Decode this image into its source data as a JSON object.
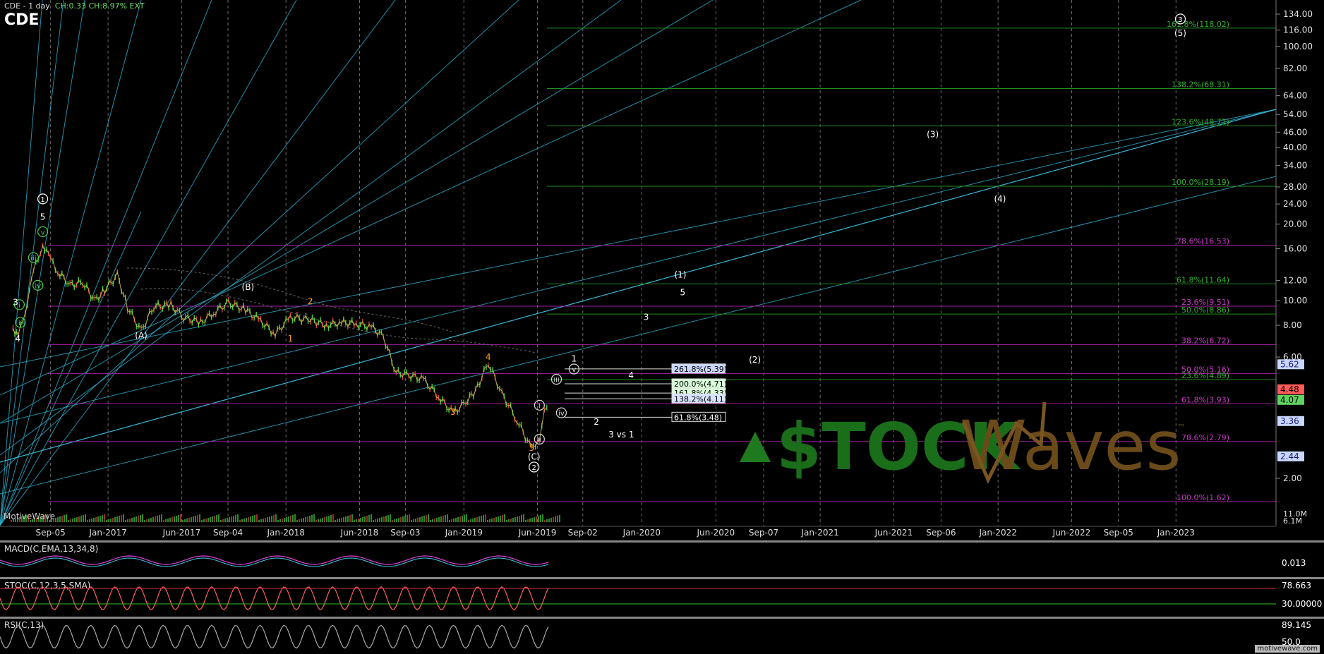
{
  "header": {
    "symbol_line": "CDE - 1 day",
    "change": "CH:0.33 CH:8.97% EXT",
    "ticker": "CDE",
    "brand": "MotiveWave",
    "watermark": "motivewave.com"
  },
  "chart_data": {
    "type": "line",
    "title": "CDE - 1 day",
    "y_scale": "log",
    "ylim": [
      1.6,
      150
    ],
    "x_ticks": [
      "Sep-05",
      "Jan-2017",
      "Jun-2017",
      "Sep-04",
      "Jan-2018",
      "Jun-2018",
      "Sep-03",
      "Jan-2019",
      "Jun-2019",
      "Sep-02",
      "Jan-2020",
      "Jun-2020",
      "Sep-07",
      "Jan-2021",
      "Jun-2021",
      "Sep-06",
      "Jan-2022",
      "Jun-2022",
      "Sep-05",
      "Jan-2023"
    ],
    "y_ticks": [
      "134.00",
      "116.00",
      "100.00",
      "82.00",
      "64.00",
      "54.00",
      "46.00",
      "40.00",
      "34.00",
      "28.00",
      "24.00",
      "20.00",
      "16.00",
      "12.00",
      "10.00",
      "8.00",
      "6.00",
      "2.00"
    ],
    "price_badges": [
      {
        "label": "5.62",
        "value": 5.62,
        "color": "#c9d6ff",
        "text_color": "#1a1a7a"
      },
      {
        "label": "4.48",
        "value": 4.48,
        "color": "#ff5a5a",
        "text_color": "#000000"
      },
      {
        "label": "4.07",
        "value": 4.07,
        "color": "#5fd35f",
        "text_color": "#000000"
      },
      {
        "label": "3.36",
        "value": 3.36,
        "color": "#c9d6ff",
        "text_color": "#1a1a7a"
      },
      {
        "label": "2.44",
        "value": 2.44,
        "color": "#c9d6ff",
        "text_color": "#1a1a7a"
      }
    ],
    "fib_lines": [
      {
        "label": "161.8%(118.02)",
        "value": 118.02,
        "color": "#1f8f1f"
      },
      {
        "label": "138.2%(68.31)",
        "value": 68.31,
        "color": "#1f8f1f"
      },
      {
        "label": "123.6%(48.71)",
        "value": 48.71,
        "color": "#1f8f1f"
      },
      {
        "label": "100.0%(28.19)",
        "value": 28.19,
        "color": "#1f8f1f"
      },
      {
        "label": "78.6%(16.53)",
        "value": 16.53,
        "color": "#a020a0"
      },
      {
        "label": "61.8%(11.64)",
        "value": 11.64,
        "color": "#1f8f1f"
      },
      {
        "label": "23.6%(9.51)",
        "value": 9.51,
        "color": "#a020a0"
      },
      {
        "label": "50.0%(8.86)",
        "value": 8.86,
        "color": "#1f8f1f"
      },
      {
        "label": "38.2%(6.72)",
        "value": 6.72,
        "color": "#a020a0"
      },
      {
        "label": "50.0%(5.16)",
        "value": 5.16,
        "color": "#a020a0"
      },
      {
        "label": "23.6%(4.89)",
        "value": 4.89,
        "color": "#1f8f1f"
      },
      {
        "label": "61.8%(3.93)",
        "value": 3.93,
        "color": "#a020a0"
      },
      {
        "label": "78.6%(2.79)",
        "value": 2.79,
        "color": "#a020a0"
      },
      {
        "label": "100.0%(1.62)",
        "value": 1.62,
        "color": "#a020a0"
      }
    ],
    "target_boxes": [
      {
        "label": "261.8%(5.39)",
        "value": 5.39,
        "bg": "#c9d6ff",
        "fg": "#000"
      },
      {
        "label": "200.0%(4.71)",
        "value": 4.71,
        "bg": "#d8ffd8",
        "fg": "#000"
      },
      {
        "label": "161.8%(4.33)",
        "value": 4.33,
        "bg": "#d8ffd8",
        "fg": "#000"
      },
      {
        "label": "138.2%(4.11)",
        "value": 4.11,
        "bg": "#d8e4ff",
        "fg": "#000"
      },
      {
        "label": "61.8%(3.48)",
        "value": 3.48,
        "bg": "#000",
        "fg": "#fff"
      }
    ],
    "wave_labels": [
      {
        "text": "1",
        "x": "2016-08-20",
        "y": 24.5,
        "circled": true,
        "color": "#fff"
      },
      {
        "text": "5",
        "x": "2016-08-20",
        "y": 20.8,
        "color": "#fff"
      },
      {
        "text": "v",
        "x": "2016-08-20",
        "y": 18.2,
        "circled": true,
        "color": "#4ccf4c"
      },
      {
        "text": "iii",
        "x": "2016-08-01",
        "y": 14.4,
        "circled": true,
        "color": "#4ccf4c"
      },
      {
        "text": "iv",
        "x": "2016-08-10",
        "y": 11.2,
        "circled": true,
        "color": "#4ccf4c"
      },
      {
        "text": "i",
        "x": "2016-07-03",
        "y": 9.4,
        "circled": true,
        "color": "#4ccf4c"
      },
      {
        "text": "ii",
        "x": "2016-07-05",
        "y": 8.0,
        "circled": true,
        "color": "#4ccf4c"
      },
      {
        "text": "3",
        "x": "2016-06-25",
        "y": 9.6,
        "color": "#fff"
      },
      {
        "text": "4",
        "x": "2016-06-30",
        "y": 6.9,
        "color": "#fff"
      },
      {
        "text": "(A)",
        "x": "2017-03-10",
        "y": 7.1,
        "color": "#fff"
      },
      {
        "text": "(B)",
        "x": "2017-10-15",
        "y": 11.0,
        "color": "#fff"
      },
      {
        "text": "1",
        "x": "2018-01-10",
        "y": 6.9,
        "color": "#ff9b1f"
      },
      {
        "text": "2",
        "x": "2018-02-20",
        "y": 9.7,
        "color": "#ff9b1f"
      },
      {
        "text": "3",
        "x": "2018-12-10",
        "y": 3.55,
        "color": "#ff9b1f"
      },
      {
        "text": "4",
        "x": "2019-02-20",
        "y": 5.85,
        "color": "#ff9b1f"
      },
      {
        "text": "5",
        "x": "2019-05-20",
        "y": 2.57,
        "color": "#ff9b1f"
      },
      {
        "text": "(C)",
        "x": "2019-05-25",
        "y": 2.37,
        "color": "#fff"
      },
      {
        "text": "2",
        "x": "2019-05-25",
        "y": 2.16,
        "circled": true,
        "color": "#fff"
      },
      {
        "text": "ii",
        "x": "2019-06-05",
        "y": 2.78,
        "circled": true,
        "color": "#ddd"
      },
      {
        "text": "i",
        "x": "2019-06-05",
        "y": 3.78,
        "circled": true,
        "color": "#ddd"
      },
      {
        "text": "iv",
        "x": "2019-07-20",
        "y": 3.53,
        "circled": true,
        "color": "#ddd"
      },
      {
        "text": "iii",
        "x": "2019-07-10",
        "y": 4.78,
        "circled": true,
        "color": "#ddd"
      },
      {
        "text": "v",
        "x": "2019-08-15",
        "y": 5.25,
        "circled": true,
        "color": "#ddd"
      },
      {
        "text": "1",
        "x": "2019-08-15",
        "y": 5.75,
        "color": "#fff"
      },
      {
        "text": "2",
        "x": "2019-09-30",
        "y": 3.25,
        "color": "#fff"
      },
      {
        "text": "4",
        "x": "2019-12-10",
        "y": 4.95,
        "color": "#fff"
      },
      {
        "text": "3",
        "x": "2020-01-10",
        "y": 8.4,
        "color": "#fff"
      },
      {
        "text": "(1)",
        "x": "2020-03-20",
        "y": 12.3,
        "color": "#fff"
      },
      {
        "text": "5",
        "x": "2020-03-25",
        "y": 10.5,
        "color": "#fff"
      },
      {
        "text": "(2)",
        "x": "2020-08-20",
        "y": 5.7,
        "color": "#fff"
      },
      {
        "text": "(3)",
        "x": "2021-08-20",
        "y": 44.0,
        "color": "#fff"
      },
      {
        "text": "(4)",
        "x": "2022-01-05",
        "y": 24.5,
        "color": "#fff"
      },
      {
        "text": "3",
        "x": "2023-01-10",
        "y": 125,
        "circled": true,
        "color": "#fff"
      },
      {
        "text": "(5)",
        "x": "2023-01-10",
        "y": 110,
        "color": "#fff"
      },
      {
        "text": "3 vs 1",
        "x": "2019-11-20",
        "y": 2.9,
        "color": "#fff"
      }
    ],
    "price_series": [
      {
        "x": "2016-06-20",
        "y": 7.8
      },
      {
        "x": "2016-07-01",
        "y": 7.3
      },
      {
        "x": "2016-07-15",
        "y": 9.0
      },
      {
        "x": "2016-08-01",
        "y": 13.0
      },
      {
        "x": "2016-08-20",
        "y": 16.7
      },
      {
        "x": "2016-09-05",
        "y": 14.5
      },
      {
        "x": "2016-09-20",
        "y": 13.0
      },
      {
        "x": "2016-10-15",
        "y": 11.5
      },
      {
        "x": "2016-11-10",
        "y": 11.8
      },
      {
        "x": "2016-12-05",
        "y": 10.0
      },
      {
        "x": "2016-12-25",
        "y": 11.0
      },
      {
        "x": "2017-01-20",
        "y": 12.6
      },
      {
        "x": "2017-02-10",
        "y": 9.4
      },
      {
        "x": "2017-03-10",
        "y": 7.6
      },
      {
        "x": "2017-04-05",
        "y": 9.5
      },
      {
        "x": "2017-05-10",
        "y": 9.6
      },
      {
        "x": "2017-06-05",
        "y": 8.6
      },
      {
        "x": "2017-07-10",
        "y": 8.2
      },
      {
        "x": "2017-08-10",
        "y": 9.1
      },
      {
        "x": "2017-09-05",
        "y": 9.8
      },
      {
        "x": "2017-10-10",
        "y": 9.2
      },
      {
        "x": "2017-11-10",
        "y": 8.3
      },
      {
        "x": "2017-12-10",
        "y": 7.4
      },
      {
        "x": "2018-01-10",
        "y": 8.6
      },
      {
        "x": "2018-02-20",
        "y": 8.4
      },
      {
        "x": "2018-03-25",
        "y": 8.0
      },
      {
        "x": "2018-04-25",
        "y": 8.2
      },
      {
        "x": "2018-05-25",
        "y": 8.1
      },
      {
        "x": "2018-06-25",
        "y": 7.9
      },
      {
        "x": "2018-07-20",
        "y": 7.2
      },
      {
        "x": "2018-08-15",
        "y": 5.2
      },
      {
        "x": "2018-09-10",
        "y": 5.1
      },
      {
        "x": "2018-10-10",
        "y": 4.9
      },
      {
        "x": "2018-11-10",
        "y": 4.2
      },
      {
        "x": "2018-12-10",
        "y": 3.6
      },
      {
        "x": "2019-01-05",
        "y": 4.0
      },
      {
        "x": "2019-01-25",
        "y": 4.4
      },
      {
        "x": "2019-02-20",
        "y": 5.7
      },
      {
        "x": "2019-03-20",
        "y": 4.3
      },
      {
        "x": "2019-04-20",
        "y": 3.4
      },
      {
        "x": "2019-05-20",
        "y": 2.6
      },
      {
        "x": "2019-06-05",
        "y": 2.9
      },
      {
        "x": "2019-06-15",
        "y": 3.6
      },
      {
        "x": "2019-06-25",
        "y": 4.0
      }
    ],
    "indicators": [
      {
        "name": "MACD(C,EMA,13,34,8)",
        "value": "0.013"
      },
      {
        "name": "STOC(C,12,3,5,SMA)",
        "value": "78.663",
        "value2": "30.00000"
      },
      {
        "name": "RSI(C,13)",
        "value": "89.145",
        "value2": "50.0"
      }
    ],
    "volume_scale": [
      "11.0M",
      "6.1M"
    ],
    "logo": {
      "text": "$TOCK",
      "text2": "Waves",
      "tm": "™"
    }
  }
}
